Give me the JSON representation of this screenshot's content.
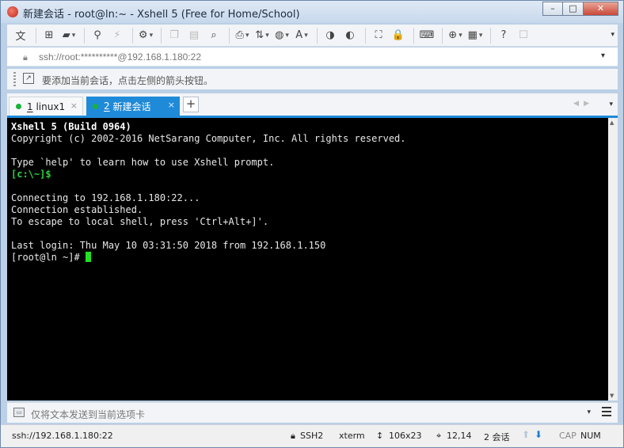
{
  "window": {
    "title": "新建会话 - root@ln:~ - Xshell 5 (Free for Home/School)",
    "buttons": {
      "minimize": "–",
      "maximize": "□",
      "close": "✕"
    }
  },
  "toolbar": {
    "items": [
      {
        "name": "language-icon",
        "glyph": "文"
      },
      {
        "name": "new-session-icon",
        "glyph": "⊞"
      },
      {
        "name": "open-folder-icon",
        "glyph": "▰"
      },
      {
        "name": "reconnect-icon",
        "glyph": "⚲"
      },
      {
        "name": "disconnect-icon",
        "glyph": "⚡"
      },
      {
        "name": "properties-icon",
        "glyph": "⚙"
      },
      {
        "name": "copy-icon",
        "glyph": "❐"
      },
      {
        "name": "paste-icon",
        "glyph": "▤"
      },
      {
        "name": "find-icon",
        "glyph": "⌕"
      },
      {
        "name": "print-icon",
        "glyph": "⎙"
      },
      {
        "name": "transfer-icon",
        "glyph": "⇅"
      },
      {
        "name": "globe-icon",
        "glyph": "◍"
      },
      {
        "name": "font-icon",
        "glyph": "A"
      },
      {
        "name": "xftp-icon",
        "glyph": "◑"
      },
      {
        "name": "xmanager-icon",
        "glyph": "◐"
      },
      {
        "name": "fullscreen-icon",
        "glyph": "⛶"
      },
      {
        "name": "lock-toolbar-icon",
        "glyph": "🔒"
      },
      {
        "name": "keyboard-icon",
        "glyph": "⌨"
      },
      {
        "name": "add-tab-icon",
        "glyph": "⊕"
      },
      {
        "name": "layout-icon",
        "glyph": "▦"
      },
      {
        "name": "help-icon",
        "glyph": "?"
      },
      {
        "name": "chat-icon",
        "glyph": "☐"
      }
    ]
  },
  "address_bar": {
    "value": "ssh://root:**********@192.168.1.180:22"
  },
  "hint_bar": {
    "text": "要添加当前会话，点击左侧的箭头按钮。"
  },
  "tabs": [
    {
      "number": "1",
      "label": "linux1",
      "active": false,
      "status_color": "#18b23a"
    },
    {
      "number": "2",
      "label": "新建会话",
      "active": true,
      "status_color": "#18b23a"
    }
  ],
  "terminal": {
    "banner_title": "Xshell 5 (Build 0964)",
    "lines": [
      "Copyright (c) 2002-2016 NetSarang Computer, Inc. All rights reserved.",
      "",
      "Type `help' to learn how to use Xshell prompt."
    ],
    "local_prompt": "[c:\\~]$",
    "session_lines": [
      "",
      "Connecting to 192.168.1.180:22...",
      "Connection established.",
      "To escape to local shell, press 'Ctrl+Alt+]'.",
      "",
      "Last login: Thu May 10 03:31:50 2018 from 192.168.1.150"
    ],
    "remote_prompt": "[root@ln ~]# "
  },
  "compose_bar": {
    "text": "仅将文本发送到当前选项卡"
  },
  "status_bar": {
    "address": "ssh://192.168.1.180:22",
    "protocol": "SSH2",
    "terminal_type": "xterm",
    "size": "106x23",
    "cursor_pos": "12,14",
    "sessions": "2 会话",
    "caps": "CAP",
    "num": "NUM"
  }
}
